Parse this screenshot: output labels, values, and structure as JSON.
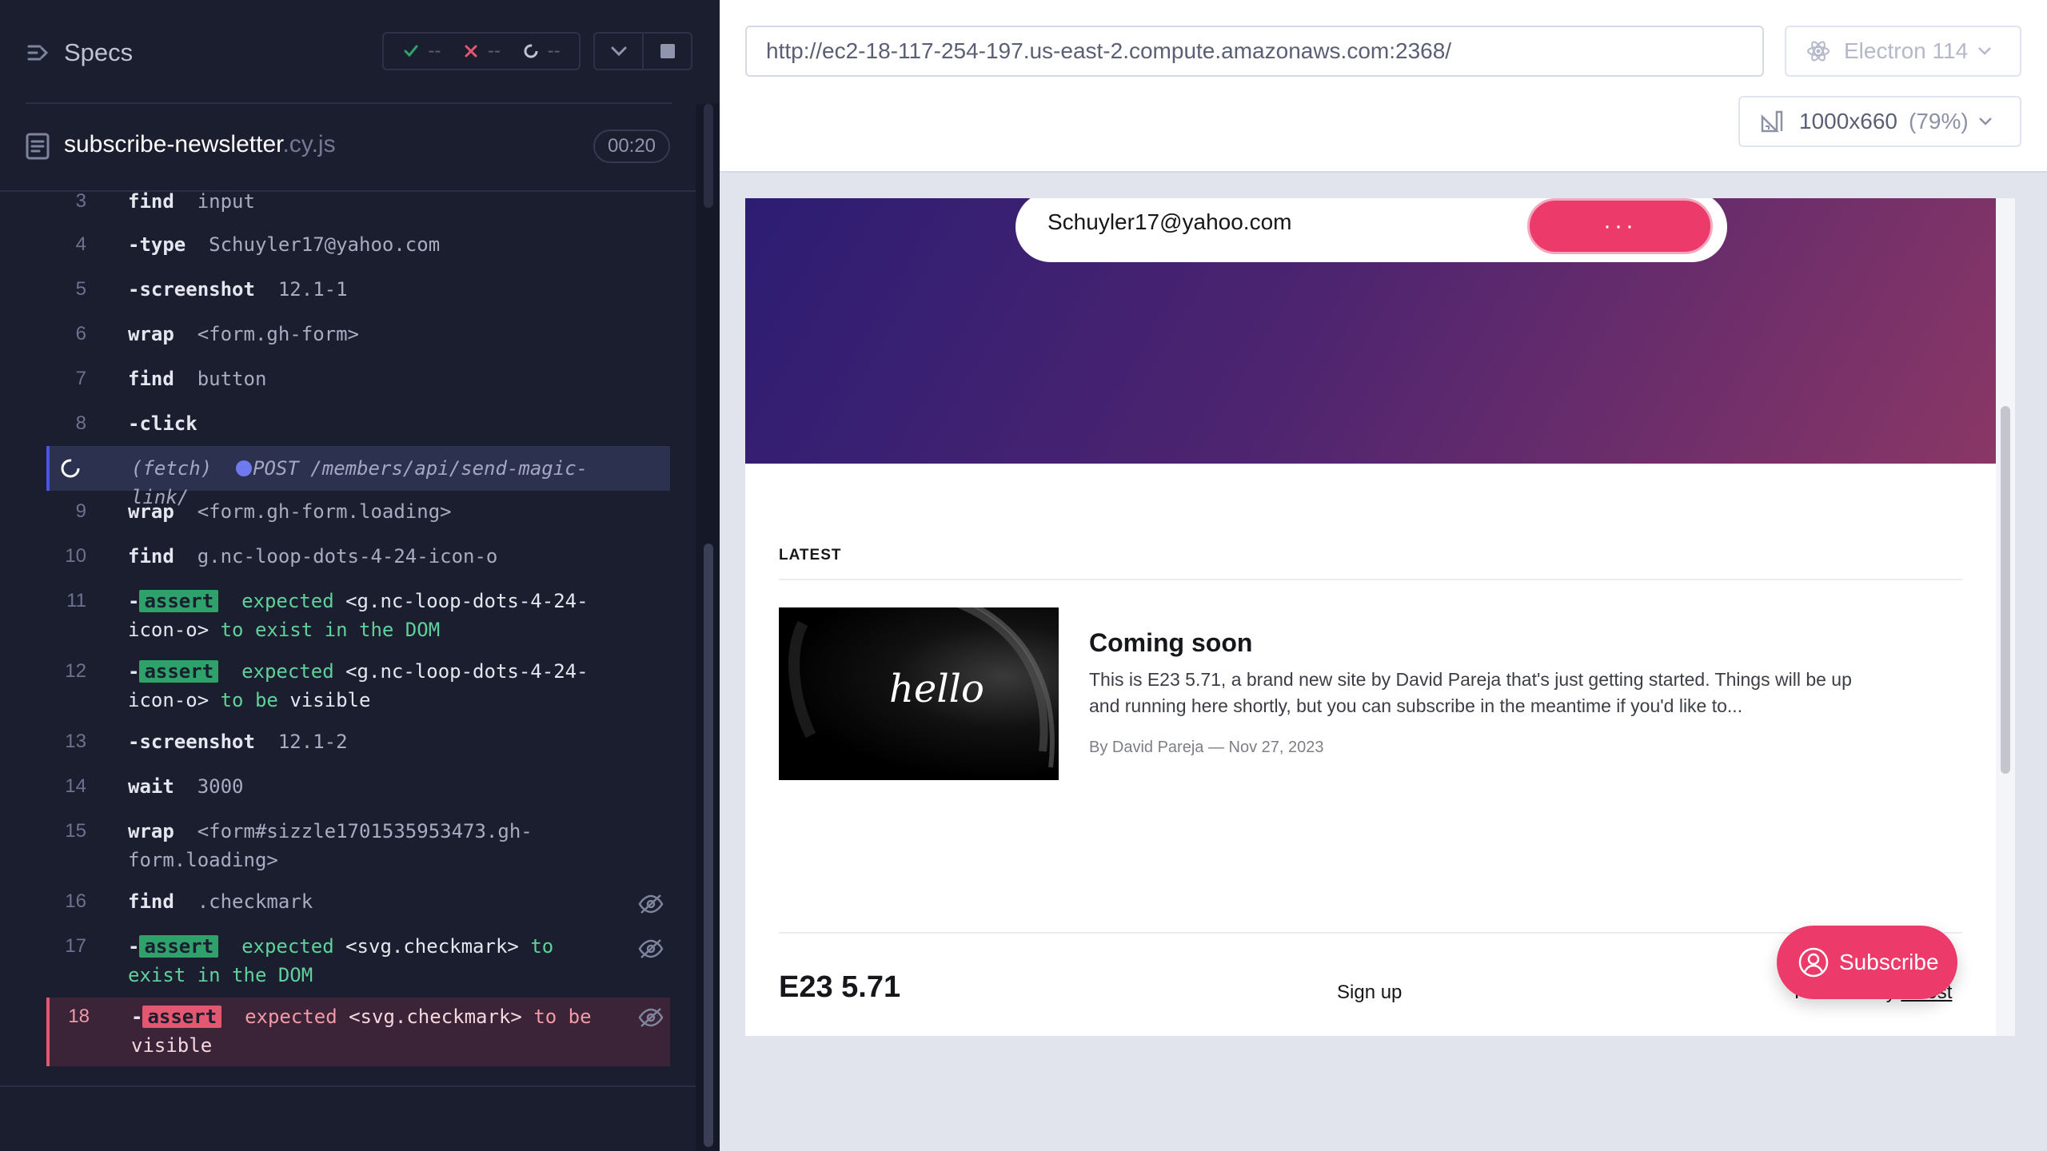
{
  "reporter": {
    "specs_label": "Specs",
    "stats": {
      "passed": "--",
      "failed": "--",
      "pending": "--"
    },
    "spec": {
      "name": "subscribe-newsletter",
      "ext": ".cy.js",
      "duration": "00:20"
    },
    "commands": [
      {
        "num": "3",
        "name": "find",
        "msg": "input"
      },
      {
        "num": "4",
        "name": "-type",
        "msg": "Schuyler17@yahoo.com"
      },
      {
        "num": "5",
        "name": "-screenshot",
        "msg": "12.1-1"
      },
      {
        "num": "6",
        "name": "wrap",
        "msg": "<form.gh-form>"
      },
      {
        "num": "7",
        "name": "find",
        "msg": "button"
      },
      {
        "num": "8",
        "name": "-click",
        "msg": ""
      },
      {
        "num": "",
        "name": "(fetch)",
        "msg": "POST /members/api/send-magic-link/"
      },
      {
        "num": "9",
        "name": "wrap",
        "msg": "<form.gh-form.loading>"
      },
      {
        "num": "10",
        "name": "find",
        "msg": "g.nc-loop-dots-4-24-icon-o"
      },
      {
        "num": "11",
        "name": "-",
        "badge": "assert",
        "a1": "expected",
        "v1": "<g.nc-loop-dots-4-24-icon-o>",
        "a2": "to exist in the DOM"
      },
      {
        "num": "12",
        "name": "-",
        "badge": "assert",
        "a1": "expected",
        "v1": "<g.nc-loop-dots-4-24-icon-o>",
        "a2": "to be",
        "v2": "visible"
      },
      {
        "num": "13",
        "name": "-screenshot",
        "msg": "12.1-2"
      },
      {
        "num": "14",
        "name": "wait",
        "msg": "3000"
      },
      {
        "num": "15",
        "name": "wrap",
        "msg": "<form#sizzle1701535953473.gh-form.loading>"
      },
      {
        "num": "16",
        "name": "find",
        "msg": ".checkmark"
      },
      {
        "num": "17",
        "name": "-",
        "badge": "assert",
        "a1": "expected",
        "v1": "<svg.checkmark>",
        "a2": "to exist in the DOM"
      },
      {
        "num": "18",
        "name": "-",
        "badge": "assert",
        "a1": "expected",
        "v1": "<svg.checkmark>",
        "a2": "to be",
        "v2": "visible"
      }
    ]
  },
  "aut_header": {
    "url": "http://ec2-18-117-254-197.us-east-2.compute.amazonaws.com:2368/",
    "browser": "Electron 114",
    "viewport": "1000x660",
    "viewport_scale": "(79%)"
  },
  "site": {
    "email_value": "Schuyler17@yahoo.com",
    "submit_label": "···",
    "latest_label": "LATEST",
    "post": {
      "image_text": "hello",
      "title": "Coming soon",
      "excerpt": "This is E23 5.71, a brand new site by David Pareja that's just getting started. Things will be up and running here shortly, but you can subscribe in the meantime if you'd like to...",
      "meta": "By David Pareja — Nov 27, 2023"
    },
    "footer": {
      "site_name": "E23 5.71",
      "signup": "Sign up",
      "powered_prefix": "Powered by ",
      "powered_link": "Ghost"
    },
    "portal_button": "Subscribe"
  },
  "colors": {
    "reporter_bg": "#1b1e2e",
    "pass": "#2fa16a",
    "fail": "#e45770",
    "pending": "#4956e3",
    "ghost_accent": "#ec3a6b"
  }
}
